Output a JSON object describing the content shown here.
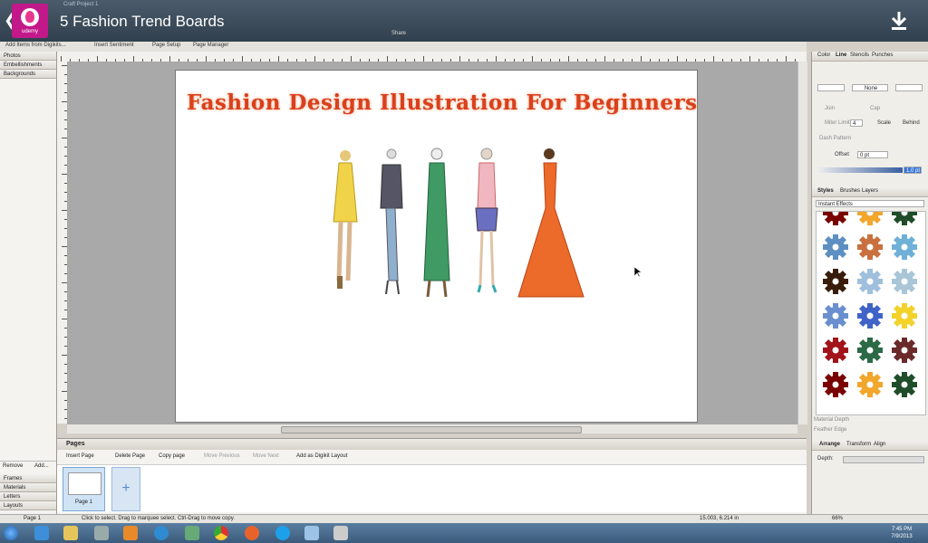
{
  "video": {
    "title": "5  Fashion Trend Boards",
    "brand": "udemy",
    "window_title_hint": "Craft Project 1"
  },
  "toolbar": {
    "add_items_label": "Add Items from Digikits...",
    "insert_sentiment_label": "Insert Sentiment",
    "page_setup_label": "Page Setup",
    "page_manager_label": "Page Manager",
    "share_label": "Share"
  },
  "left_panel": {
    "tabs": [
      "Photos",
      "Embellishments",
      "Backgrounds"
    ],
    "remove_label": "Remove",
    "add_label": "Add...",
    "bottom_tabs": [
      "Frames",
      "Materials",
      "Letters",
      "Layouts"
    ]
  },
  "canvas": {
    "page_title": "Fashion Design Illustration For Beginners"
  },
  "pages_panel": {
    "header": "Pages",
    "insert_page": "Insert Page",
    "delete_page": "Delete Page",
    "copy_page": "Copy page",
    "move_previous": "Move Previous",
    "move_next": "Move Next",
    "add_digikit": "Add as Digikit Layout",
    "page1_label": "Page 1"
  },
  "right_panel": {
    "tabs_top": [
      "Color",
      "Line",
      "Stencils",
      "Punches"
    ],
    "line_style_value": "None",
    "join_label": "Join",
    "cap_label": "Cap",
    "miter_label": "Miter Limit",
    "miter_value": "4",
    "scale_label": "Scale",
    "behind_label": "Behind",
    "dash_label": "Dash Pattern",
    "offset_label": "Offset",
    "offset_value": "0 pt",
    "width_value": "1.0 pt",
    "tabs_mid": [
      "Styles",
      "Brushes",
      "Layers"
    ],
    "effects_dropdown": "Instant Effects",
    "material_depth": "Material Depth",
    "feather_edge": "Feather Edge",
    "tabs_bottom": [
      "Arrange",
      "Transform",
      "Align"
    ],
    "depth_label": "Depth:"
  },
  "status": {
    "page": "Page 1",
    "hint": "Click to select. Drag to marquee select. Ctrl-Drag to move copy.",
    "coords": "15.003, 6.214 in",
    "zoom": "66%"
  },
  "taskbar": {
    "time": "7:45 PM",
    "date": "7/9/2013"
  },
  "colors": {
    "title_orange": "#d9401b",
    "udemy_pink": "#c2188a",
    "canvas_gray": "#a9a9a9"
  }
}
